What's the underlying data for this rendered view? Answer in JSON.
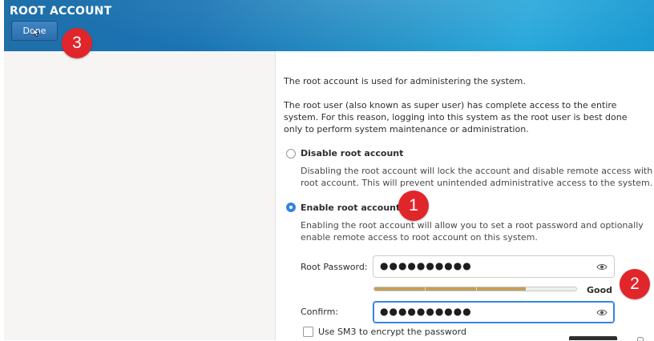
{
  "header": {
    "title": "ROOT ACCOUNT",
    "done_label": "Done"
  },
  "intro": {
    "line1": "The root account is used for administering the system.",
    "line2": "The root user (also known as super user) has complete access to the entire system. For this reason, logging into this system as the root user is best done only to perform system maintenance or administration."
  },
  "options": {
    "disable": {
      "label": "Disable root account",
      "description": "Disabling the root account will lock the account and disable remote access with root account. This will prevent unintended administrative access to the system.",
      "selected": false
    },
    "enable": {
      "label": "Enable root account",
      "description": "Enabling the root account will allow you to set a root password and optionally enable remote access to root account on this system.",
      "selected": true
    }
  },
  "form": {
    "root_password_label": "Root Password:",
    "root_password_value": "●●●●●●●●●●",
    "confirm_label": "Confirm:",
    "confirm_value": "●●●●●●●●●●",
    "strength_text": "Good",
    "strength_fraction": 0.75,
    "sm3_label": "Use SM3 to encrypt the password",
    "sm3_checked": false
  },
  "annotations": {
    "badge_1": "1",
    "badge_2": "2",
    "badge_3": "3"
  },
  "colors": {
    "accent": "#3584e4",
    "badge": "#e0262a",
    "strength": "#c1a05a"
  }
}
